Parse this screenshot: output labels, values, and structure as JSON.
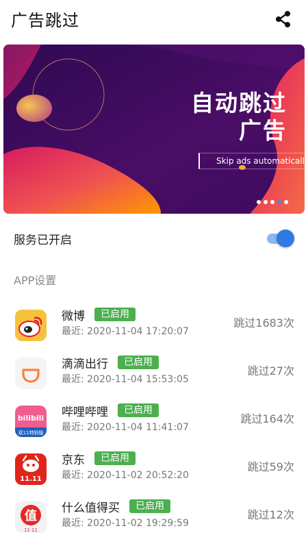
{
  "header": {
    "title": "广告跳过",
    "share_icon": "share-icon"
  },
  "banner": {
    "headline_line1": "自动跳过",
    "headline_line2": "广告",
    "subline": "Skip ads automatically",
    "page_count": 5,
    "active_page": 4,
    "colors": {
      "deep_purple": "#3b0b5e",
      "magenta": "#c2185b",
      "orange": "#f57c00",
      "pink": "#e94b6b"
    }
  },
  "service": {
    "label": "服务已开启",
    "enabled": true,
    "accent": "#2f7ae5"
  },
  "section": {
    "title": "APP设置"
  },
  "apps": [
    {
      "name": "微博",
      "badge": "已启用",
      "recent": "最近: 2020-11-04 17:20:07",
      "count": "跳过1683次",
      "icon": "weibo-icon"
    },
    {
      "name": "滴滴出行",
      "badge": "已启用",
      "recent": "最近: 2020-11-04 15:53:05",
      "count": "跳过27次",
      "icon": "didi-icon"
    },
    {
      "name": "哔哩哔哩",
      "badge": "已启用",
      "recent": "最近: 2020-11-04 11:41:07",
      "count": "跳过164次",
      "icon": "bilibili-icon"
    },
    {
      "name": "京东",
      "badge": "已启用",
      "recent": "最近: 2020-11-02 20:52:20",
      "count": "跳过59次",
      "icon": "jd-icon"
    },
    {
      "name": "什么值得买",
      "badge": "已启用",
      "recent": "最近: 2020-11-02 19:29:59",
      "count": "跳过12次",
      "icon": "smzdm-icon"
    }
  ],
  "icon_text": {
    "bilibili_logo": "bilibili",
    "bilibili_sub": "双11特别版",
    "jd_sub": "11.11",
    "smzdm_logo": "值",
    "smzdm_sub": "11·11"
  },
  "badge_color": "#4caf50"
}
